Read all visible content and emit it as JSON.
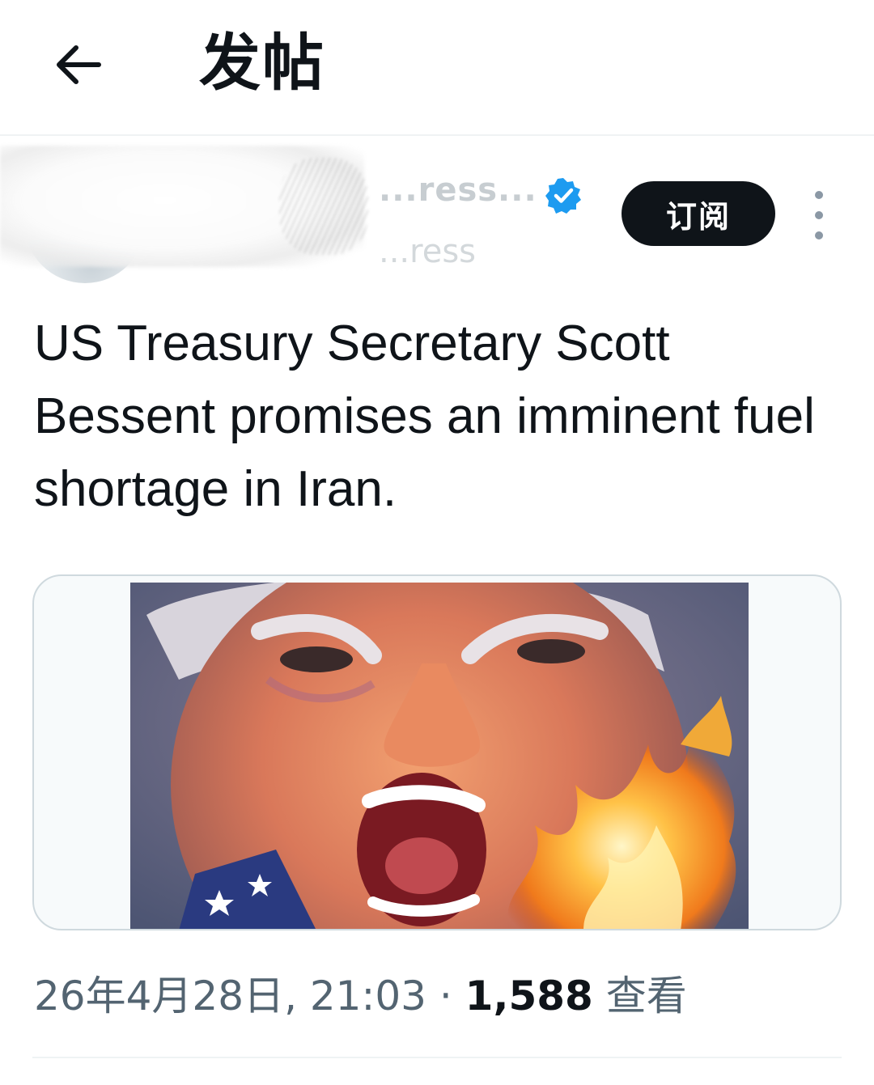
{
  "header": {
    "back_icon": "arrow-left-icon",
    "title": "发帖"
  },
  "author": {
    "display_name": "...ress...",
    "handle": "...ress",
    "verified_icon": "verified-badge-icon",
    "verified_color": "#1d9bf0",
    "subscribe_label": "订阅",
    "more_icon": "more-vertical-icon"
  },
  "tweet": {
    "text": "US Treasury Secretary Scott Bessent promises an imminent fuel shortage in Iran."
  },
  "media": {
    "icon": "photo-icon"
  },
  "meta": {
    "date": "26年4月28日",
    "time": "21:03",
    "separator": "·",
    "views_count": "1,588",
    "views_label": "查看"
  },
  "colors": {
    "text_primary": "#0f1419",
    "text_secondary": "#536471",
    "border": "#cfd9de",
    "accent": "#1d9bf0"
  }
}
